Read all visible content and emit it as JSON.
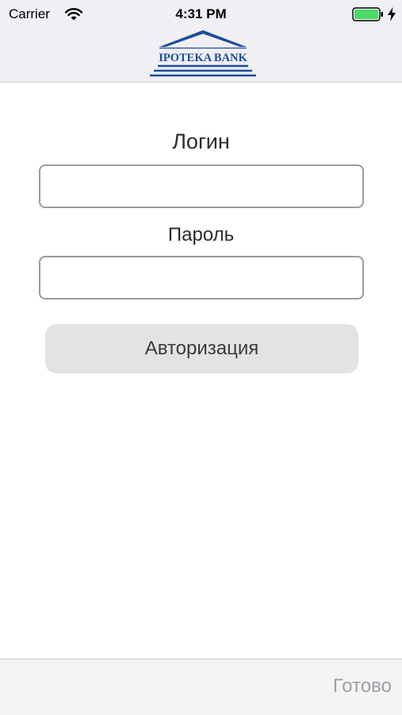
{
  "status_bar": {
    "carrier": "Carrier",
    "time": "4:31 PM"
  },
  "header": {
    "logo_text": "IPOTEKA BANK"
  },
  "form": {
    "login_label": "Логин",
    "login_value": "",
    "password_label": "Пароль",
    "password_value": "",
    "submit_label": "Авторизация"
  },
  "toolbar": {
    "done_label": "Готово"
  },
  "colors": {
    "brand": "#1e4c97",
    "battery": "#4cd964",
    "nav_background": "#efeff4",
    "button_background": "#e3e3e3"
  },
  "icons": {
    "wifi": "wifi-icon",
    "battery": "battery-icon",
    "charging": "charging-bolt-icon",
    "logo": "ipoteka-bank-logo"
  }
}
